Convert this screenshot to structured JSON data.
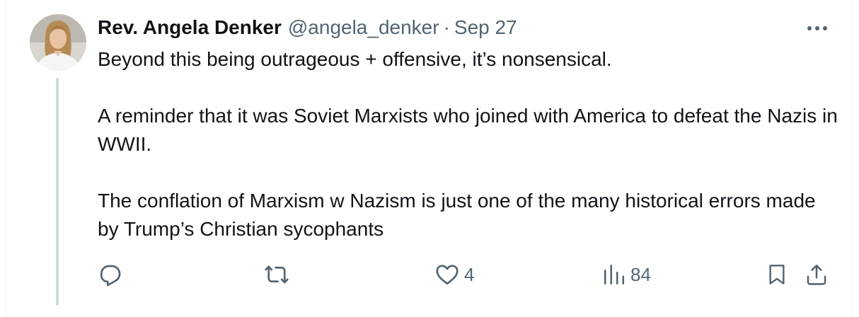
{
  "tweet": {
    "display_name": "Rev. Angela Denker",
    "handle": "@angela_denker",
    "separator": "·",
    "timestamp": "Sep 27",
    "paragraphs": [
      "Beyond this being outrageous + offensive, it’s nonsensical.",
      "A reminder that it was Soviet Marxists who joined with America to defeat the Nazis in WWII.",
      "The conflation of Marxism w Nazism is just one of the many historical errors made by Trump’s Christian sycophants"
    ]
  },
  "actions": {
    "reply": {
      "icon": "reply-icon"
    },
    "retweet": {
      "icon": "retweet-icon"
    },
    "like": {
      "icon": "heart-icon",
      "count": "4"
    },
    "views": {
      "icon": "views-icon",
      "count": "84"
    },
    "bookmark": {
      "icon": "bookmark-icon"
    },
    "share": {
      "icon": "share-icon"
    }
  },
  "colors": {
    "text": "#0f1419",
    "secondary": "#536471",
    "thread_line": "#cfd9de",
    "border": "#eff3f4"
  }
}
